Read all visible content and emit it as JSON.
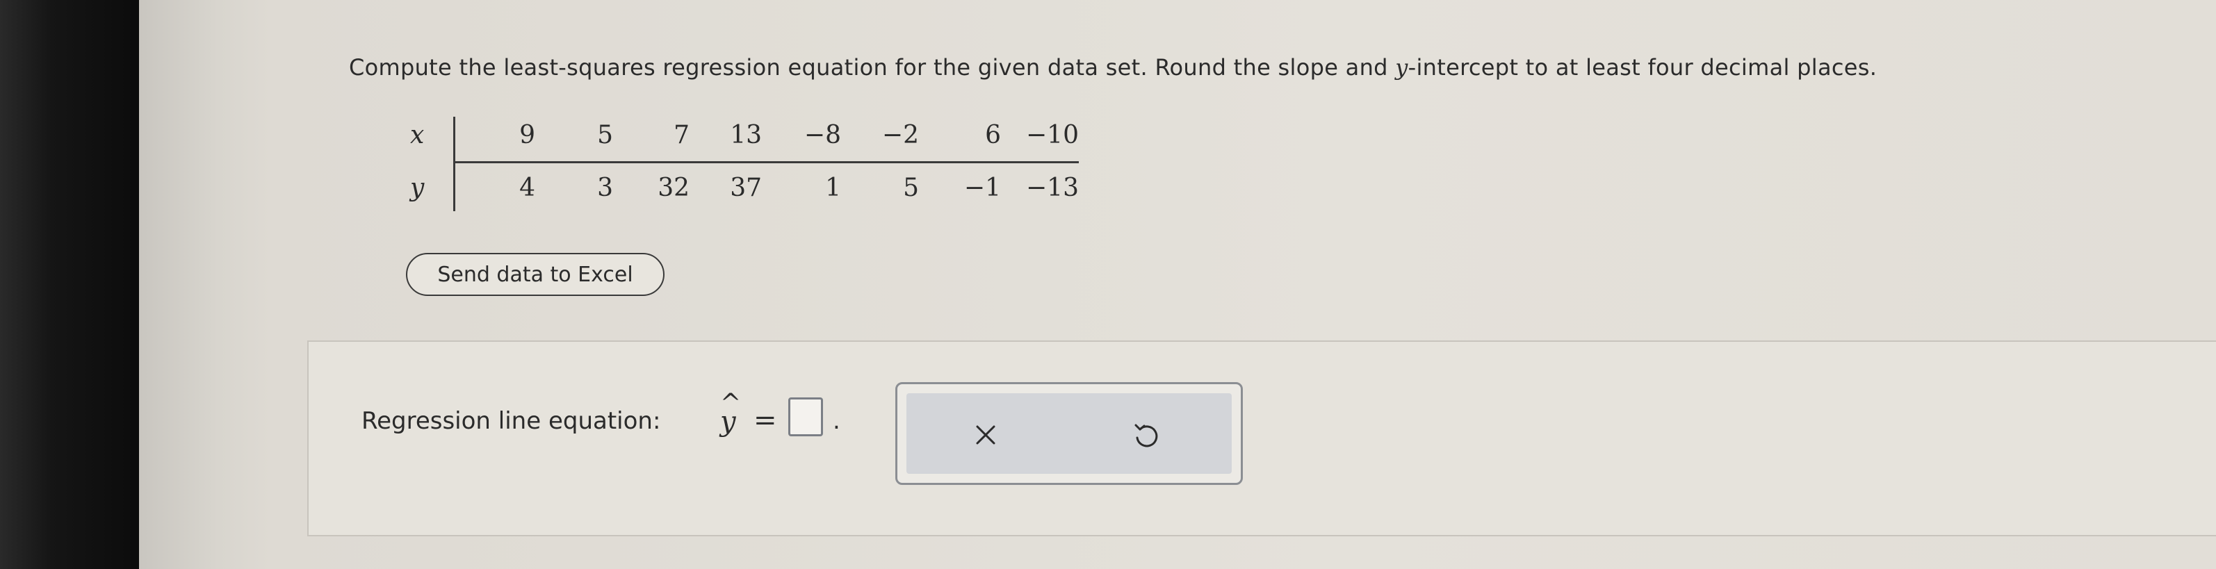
{
  "question": {
    "text_before": "Compute the least-squares regression equation for the given data set. Round the slope and ",
    "var_y": "y",
    "text_after": "-intercept to at least four decimal places."
  },
  "table": {
    "x_label": "x",
    "y_label": "y",
    "x_values": [
      "9",
      "5",
      "7",
      "13",
      "−8",
      "−2",
      "6",
      "−10"
    ],
    "y_values": [
      "4",
      "3",
      "32",
      "37",
      "1",
      "5",
      "−1",
      "−13"
    ]
  },
  "send_button": {
    "label": "Send data to Excel"
  },
  "answer": {
    "label": "Regression line equation:",
    "hat_symbol": "^",
    "yhat_var": "y",
    "equals": "=",
    "input_value": "",
    "period": "."
  },
  "actions": {
    "clear_icon": "close-icon",
    "undo_icon": "undo-icon"
  },
  "colors": {
    "background": "#dedad3",
    "text": "#2b2b2b",
    "action_bg": "#d3d5d9"
  }
}
